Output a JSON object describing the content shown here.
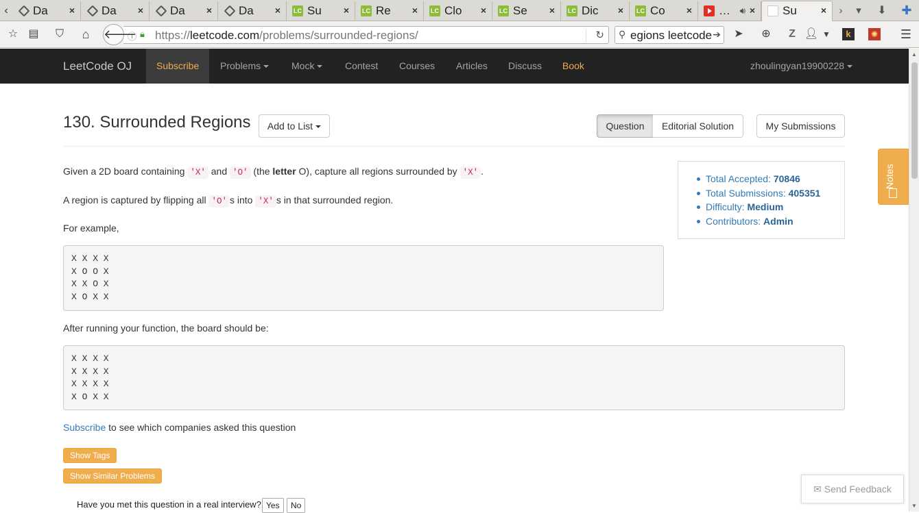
{
  "browser": {
    "tabs": [
      {
        "title": "Da",
        "icon": "diamond-icon"
      },
      {
        "title": "Da",
        "icon": "diamond-icon"
      },
      {
        "title": "Da",
        "icon": "diamond-icon"
      },
      {
        "title": "Da",
        "icon": "diamond-icon"
      },
      {
        "title": "Su",
        "icon": "leetcode-icon",
        "icon_text": "LC"
      },
      {
        "title": "Re",
        "icon": "leetcode-icon",
        "icon_text": "LC"
      },
      {
        "title": "Clo",
        "icon": "leetcode-icon",
        "icon_text": "LC"
      },
      {
        "title": "Se",
        "icon": "leetcode-icon",
        "icon_text": "LC"
      },
      {
        "title": "Dic",
        "icon": "leetcode-icon",
        "icon_text": "LC"
      },
      {
        "title": "Co",
        "icon": "leetcode-icon",
        "icon_text": "LC"
      },
      {
        "title": "…",
        "icon": "youtube-icon"
      },
      {
        "title": "Su",
        "icon": "gmail-icon",
        "active": true
      }
    ],
    "url_prefix": "https://",
    "url_host": "leetcode.com",
    "url_path": "/problems/surrounded-regions/",
    "search_text": "egions leetcode"
  },
  "header": {
    "brand": "LeetCode OJ",
    "nav": {
      "subscribe": "Subscribe",
      "problems": "Problems",
      "mock": "Mock",
      "contest": "Contest",
      "courses": "Courses",
      "articles": "Articles",
      "discuss": "Discuss",
      "book": "Book"
    },
    "user": "zhoulingyan19900228"
  },
  "question": {
    "title": "130. Surrounded Regions",
    "add_to_list": "Add to List",
    "tab_question": "Question",
    "tab_editorial": "Editorial Solution",
    "my_submissions": "My Submissions",
    "p1": {
      "a": "Given a 2D board containing ",
      "code_x": "'X'",
      "b": " and ",
      "code_o": "'O'",
      "c": " (the ",
      "letter": "letter",
      "d": " O), capture all regions surrounded by ",
      "code_x2": "'X'",
      "e": "."
    },
    "p2": {
      "a": "A region is captured by flipping all ",
      "code_o": "'O'",
      "b": "s into ",
      "code_x": "'X'",
      "c": "s in that surrounded region."
    },
    "p3": "For example,",
    "board_before": "X X X X\nX O O X\nX X O X\nX O X X",
    "p4": "After running your function, the board should be:",
    "board_after": "X X X X\nX X X X\nX X X X\nX O X X",
    "subscribe_link": "Subscribe",
    "subscribe_rest": " to see which companies asked this question",
    "show_tags": "Show Tags",
    "show_similar": "Show Similar Problems",
    "interview_q": "Have you met this question in a real interview?",
    "yes": "Yes",
    "no": "No"
  },
  "stats": {
    "accepted_label": "Total Accepted: ",
    "accepted_value": "70846",
    "submissions_label": "Total Submissions: ",
    "submissions_value": "405351",
    "difficulty_label": "Difficulty: ",
    "difficulty_value": "Medium",
    "contributors_label": "Contributors: ",
    "contributors_value": "Admin"
  },
  "notes": "Notes",
  "feedback": "Send Feedback",
  "colors": {
    "navbar_bg": "#222222",
    "accent_orange": "#f0ad4e",
    "link_blue": "#337ab7",
    "code_red": "#c7254e"
  }
}
